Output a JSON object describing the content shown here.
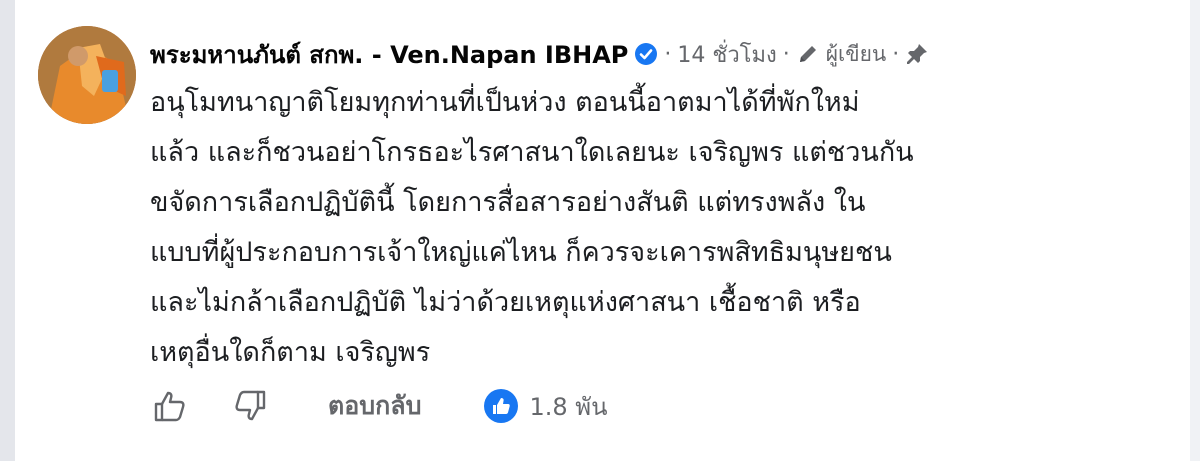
{
  "comment": {
    "author": "พระมหานภันต์ สกพ. - Ven.Napan IBHAP",
    "time": "14 ชั่วโมง",
    "role": "ผู้เขียน",
    "lines": [
      "อนุโมทนาญาติโยมทุกท่านที่เป็นห่วง ตอนนี้อาตมาได้ที่พักใหม่",
      "แล้ว และก็ชวนอย่าโกรธอะไรศาสนาใดเลยนะ เจริญพร แต่ชวนกัน",
      "ขจัดการเลือกปฏิบัตินี้ โดยการสื่อสารอย่างสันติ แต่ทรงพลัง ใน",
      "แบบที่ผู้ประกอบการเจ้าใหญ่แค่ไหน ก็ควรจะเคารพสิทธิมนุษยชน",
      "และไม่กล้าเลือกปฏิบัติ ไม่ว่าด้วยเหตุแห่งศาสนา เชื้อชาติ หรือ",
      "เหตุอื่นใดก็ตาม เจริญพร"
    ]
  },
  "actions": {
    "reply_label": "ตอบกลับ",
    "like_count": "1.8 พัน"
  },
  "colors": {
    "verified": "#1877f2",
    "like_badge": "#1877f2",
    "secondary_text": "#65676b"
  }
}
